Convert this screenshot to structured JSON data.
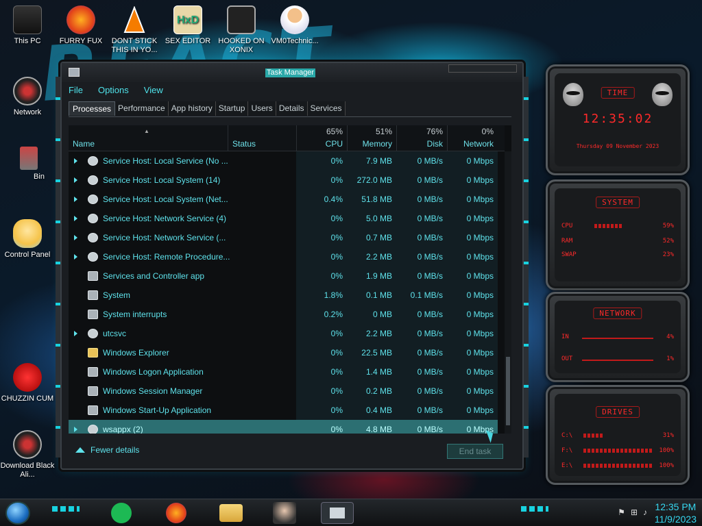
{
  "desktop": {
    "icons": [
      {
        "label": "This PC",
        "icon": "computer-icon"
      },
      {
        "label": "FURRY FUX",
        "icon": "firefox-icon"
      },
      {
        "label": "DONT STICK THIS IN YO...",
        "icon": "vlc-icon"
      },
      {
        "label": "SEX EDITOR",
        "icon": "hex-editor-icon"
      },
      {
        "label": "HOOKED ON XONIX",
        "icon": "game-icon"
      },
      {
        "label": "VM0Technic...",
        "icon": "doctor-icon"
      },
      {
        "label": "Network",
        "icon": "network-icon"
      },
      {
        "label": "Bin",
        "icon": "recycle-bin-icon"
      },
      {
        "label": "Control Panel",
        "icon": "control-panel-icon"
      },
      {
        "label": "CHUZZIN CUM",
        "icon": "chuzzle-icon"
      },
      {
        "label": "Download Black Ali...",
        "icon": "download-icon"
      }
    ]
  },
  "task_manager": {
    "title": "Task Manager",
    "menu": [
      "File",
      "Options",
      "View"
    ],
    "tabs": [
      "Processes",
      "Performance",
      "App history",
      "Startup",
      "Users",
      "Details",
      "Services"
    ],
    "active_tab": "Processes",
    "columns": {
      "name": "Name",
      "status": "Status",
      "cpu": {
        "label": "CPU",
        "pct": "65%"
      },
      "memory": {
        "label": "Memory",
        "pct": "51%"
      },
      "disk": {
        "label": "Disk",
        "pct": "76%"
      },
      "network": {
        "label": "Network",
        "pct": "0%"
      }
    },
    "rows": [
      {
        "name": "Service Host: Local Service (No ...",
        "cpu": "0%",
        "memory": "7.9 MB",
        "disk": "0 MB/s",
        "network": "0 Mbps",
        "expandable": true,
        "icon": "gear"
      },
      {
        "name": "Service Host: Local System (14)",
        "cpu": "0%",
        "memory": "272.0 MB",
        "disk": "0 MB/s",
        "network": "0 Mbps",
        "expandable": true,
        "icon": "gear"
      },
      {
        "name": "Service Host: Local System (Net...",
        "cpu": "0.4%",
        "memory": "51.8 MB",
        "disk": "0 MB/s",
        "network": "0 Mbps",
        "expandable": true,
        "icon": "gear"
      },
      {
        "name": "Service Host: Network Service (4)",
        "cpu": "0%",
        "memory": "5.0 MB",
        "disk": "0 MB/s",
        "network": "0 Mbps",
        "expandable": true,
        "icon": "gear"
      },
      {
        "name": "Service Host: Network Service (...",
        "cpu": "0%",
        "memory": "0.7 MB",
        "disk": "0 MB/s",
        "network": "0 Mbps",
        "expandable": true,
        "icon": "gear"
      },
      {
        "name": "Service Host: Remote Procedure...",
        "cpu": "0%",
        "memory": "2.2 MB",
        "disk": "0 MB/s",
        "network": "0 Mbps",
        "expandable": true,
        "icon": "gear"
      },
      {
        "name": "Services and Controller app",
        "cpu": "0%",
        "memory": "1.9 MB",
        "disk": "0 MB/s",
        "network": "0 Mbps",
        "expandable": false,
        "icon": "window"
      },
      {
        "name": "System",
        "cpu": "1.8%",
        "memory": "0.1 MB",
        "disk": "0.1 MB/s",
        "network": "0 Mbps",
        "expandable": false,
        "icon": "window"
      },
      {
        "name": "System interrupts",
        "cpu": "0.2%",
        "memory": "0 MB",
        "disk": "0 MB/s",
        "network": "0 Mbps",
        "expandable": false,
        "icon": "window"
      },
      {
        "name": "utcsvc",
        "cpu": "0%",
        "memory": "2.2 MB",
        "disk": "0 MB/s",
        "network": "0 Mbps",
        "expandable": true,
        "icon": "gear"
      },
      {
        "name": "Windows Explorer",
        "cpu": "0%",
        "memory": "22.5 MB",
        "disk": "0 MB/s",
        "network": "0 Mbps",
        "expandable": false,
        "icon": "folder"
      },
      {
        "name": "Windows Logon Application",
        "cpu": "0%",
        "memory": "1.4 MB",
        "disk": "0 MB/s",
        "network": "0 Mbps",
        "expandable": false,
        "icon": "window"
      },
      {
        "name": "Windows Session Manager",
        "cpu": "0%",
        "memory": "0.2 MB",
        "disk": "0 MB/s",
        "network": "0 Mbps",
        "expandable": false,
        "icon": "window"
      },
      {
        "name": "Windows Start-Up Application",
        "cpu": "0%",
        "memory": "0.4 MB",
        "disk": "0 MB/s",
        "network": "0 Mbps",
        "expandable": false,
        "icon": "window"
      },
      {
        "name": "wsappx (2)",
        "cpu": "0%",
        "memory": "4.8 MB",
        "disk": "0 MB/s",
        "network": "0 Mbps",
        "expandable": true,
        "icon": "gear",
        "selected": true
      }
    ],
    "fewer_details": "Fewer details",
    "end_task": "End task"
  },
  "widgets": {
    "time": {
      "title": "TIME",
      "time": "12:35:02",
      "date": "Thursday 09 November 2023"
    },
    "system": {
      "title": "SYSTEM",
      "cpu_label": "CPU",
      "cpu": "59%",
      "ram_label": "RAM",
      "ram": "52%",
      "swap_label": "SWAP",
      "swap": "23%"
    },
    "network": {
      "title": "NETWORK",
      "in_label": "IN",
      "in": "4%",
      "out_label": "OUT",
      "out": "1%"
    },
    "drives": {
      "title": "DRIVES",
      "c_label": "C:\\",
      "c": "31%",
      "f_label": "F:\\",
      "f": "100%",
      "e_label": "E:\\",
      "e": "100%"
    }
  },
  "taskbar": {
    "time": "12:35 PM",
    "date": "11/9/2023",
    "apps": [
      "spotify-icon",
      "firefox-icon",
      "file-explorer-icon",
      "photo-thumbnail-icon",
      "task-manager-icon"
    ]
  },
  "colors": {
    "accent": "#5fe3ec",
    "widget_red": "#ff2a2a"
  }
}
